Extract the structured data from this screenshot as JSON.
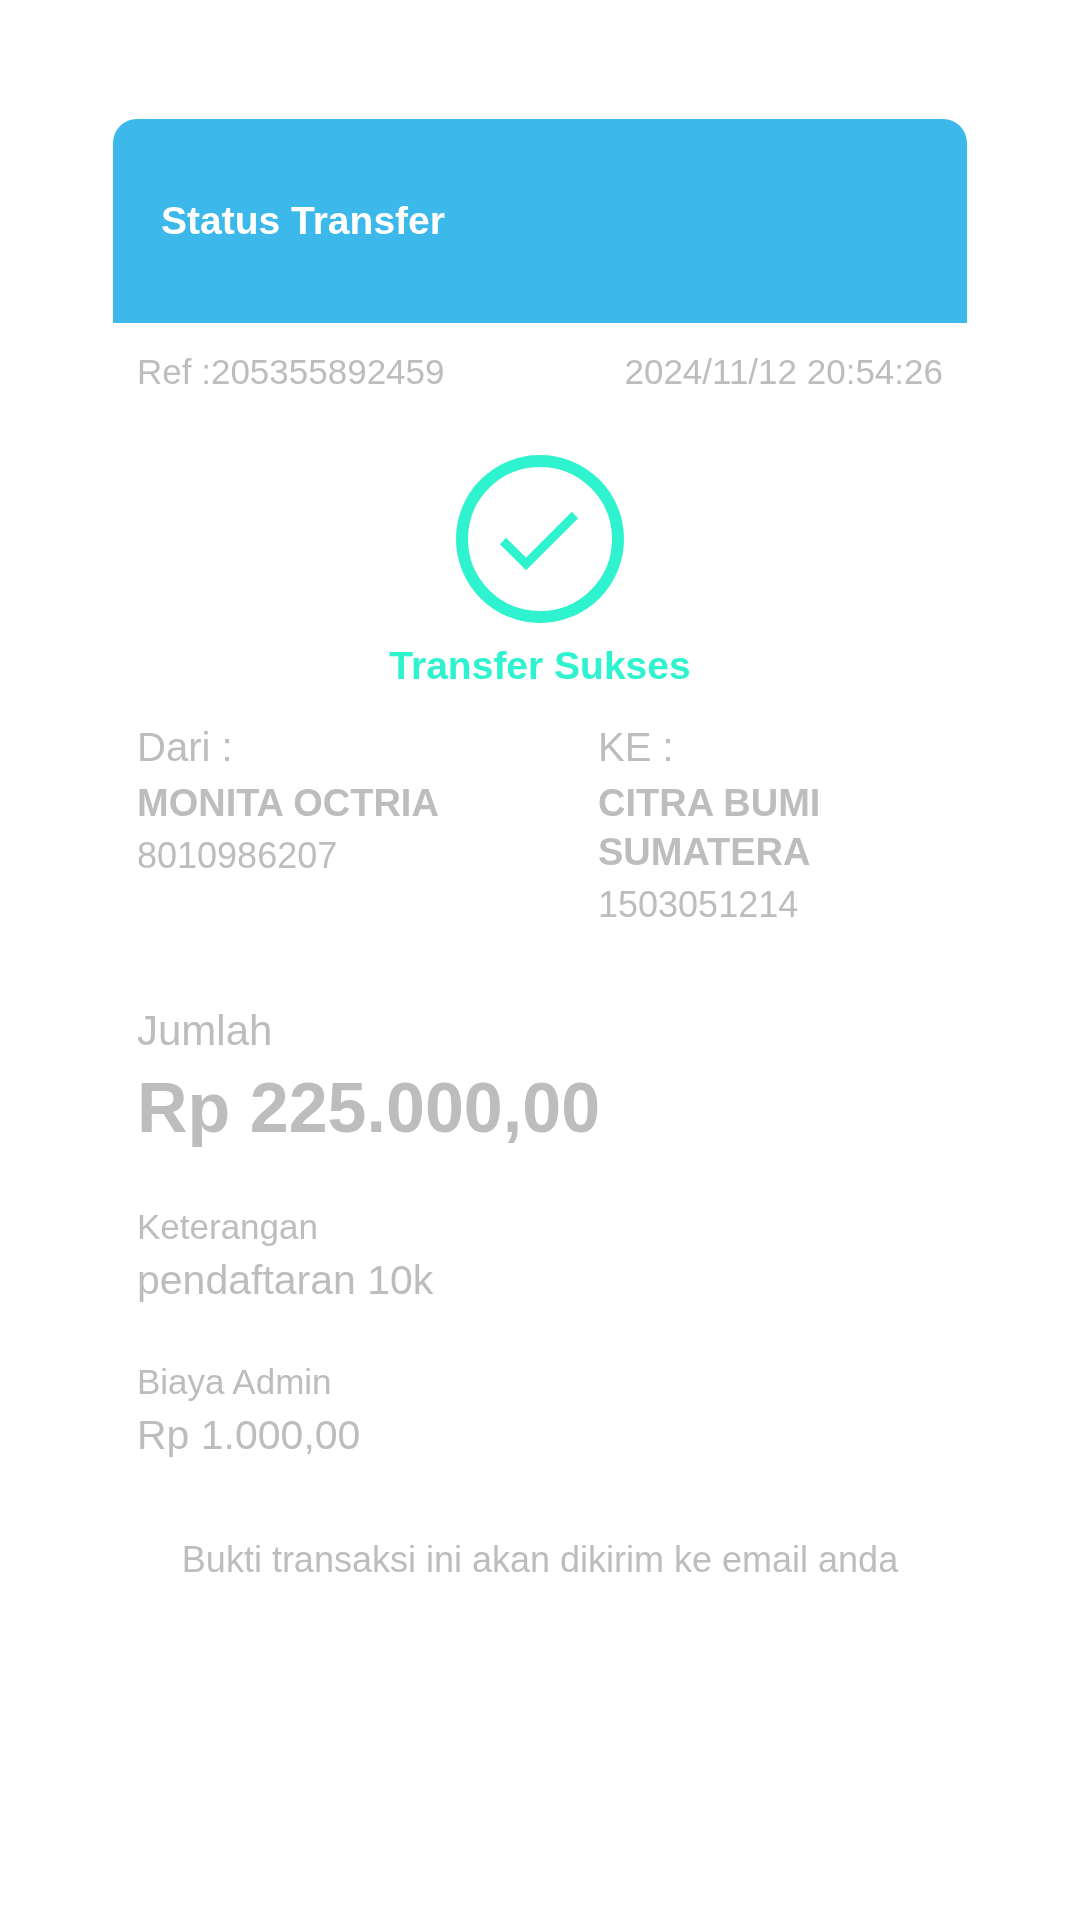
{
  "header": {
    "title": "Status Transfer"
  },
  "meta": {
    "reference": "Ref :205355892459",
    "timestamp": "2024/11/12 20:54:26"
  },
  "status": {
    "kind": "success",
    "label": "Transfer Sukses"
  },
  "parties": [
    {
      "label": "Dari :",
      "name": "MONITA OCTRIA",
      "account": "8010986207"
    },
    {
      "label": "KE :",
      "name": "CITRA BUMI SUMATERA",
      "account": "1503051214"
    }
  ],
  "amount": {
    "label": "Jumlah",
    "value": "Rp 225.000,00"
  },
  "details": [
    {
      "label": "Keterangan",
      "value": "pendaftaran 10k"
    },
    {
      "label": "Biaya Admin",
      "value": "Rp 1.000,00"
    }
  ],
  "footer_note": "Bukti transaksi ini akan dikirim ke email anda"
}
